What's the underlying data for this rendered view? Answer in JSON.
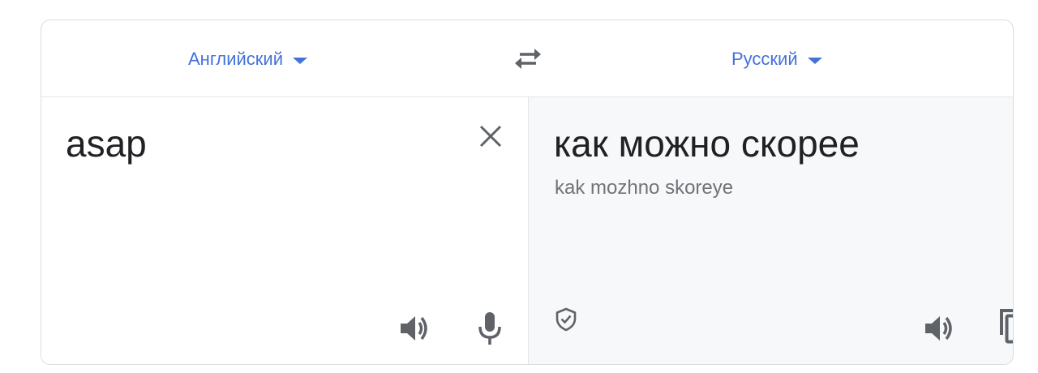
{
  "languages": {
    "source": "Английский",
    "target": "Русский"
  },
  "source": {
    "text": "asap"
  },
  "target": {
    "translation": "как можно скорее",
    "transliteration": "kak mozhno skoreye"
  },
  "icons": {
    "swap": "swap-arrows-icon",
    "clear": "close-icon",
    "speaker": "speaker-icon",
    "mic": "microphone-icon",
    "verified": "shield-check-icon",
    "copy": "copy-icon"
  },
  "colors": {
    "accent": "#4472d8",
    "icon": "#5f6368",
    "target_bg": "#f7f8f9"
  }
}
